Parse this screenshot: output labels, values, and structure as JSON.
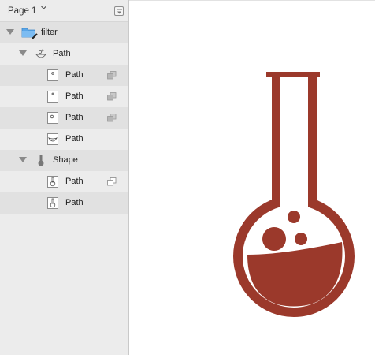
{
  "page_selector": {
    "label": "Page 1",
    "caret_icon": "chevron-down-icon",
    "menu_icon": "page-menu-icon"
  },
  "layers": [
    {
      "label": "filter",
      "icon": "folder-icon"
    },
    {
      "label": "Path",
      "icon": "group-path-icon"
    },
    {
      "label": "Path",
      "icon": "path-thumbnail-icon"
    },
    {
      "label": "Path",
      "icon": "path-thumbnail-icon"
    },
    {
      "label": "Path",
      "icon": "path-thumbnail-icon"
    },
    {
      "label": "Path",
      "icon": "path-thumbnail-icon"
    },
    {
      "label": "Shape",
      "icon": "flask-shape-icon"
    },
    {
      "label": "Path",
      "icon": "path-thumbnail-icon"
    },
    {
      "label": "Path",
      "icon": "path-thumbnail-icon"
    }
  ],
  "colors": {
    "flask": "#9b392b",
    "folder": "#5aa6e8",
    "panel_bg": "#ececec",
    "row_alt": "#e1e1e1"
  }
}
